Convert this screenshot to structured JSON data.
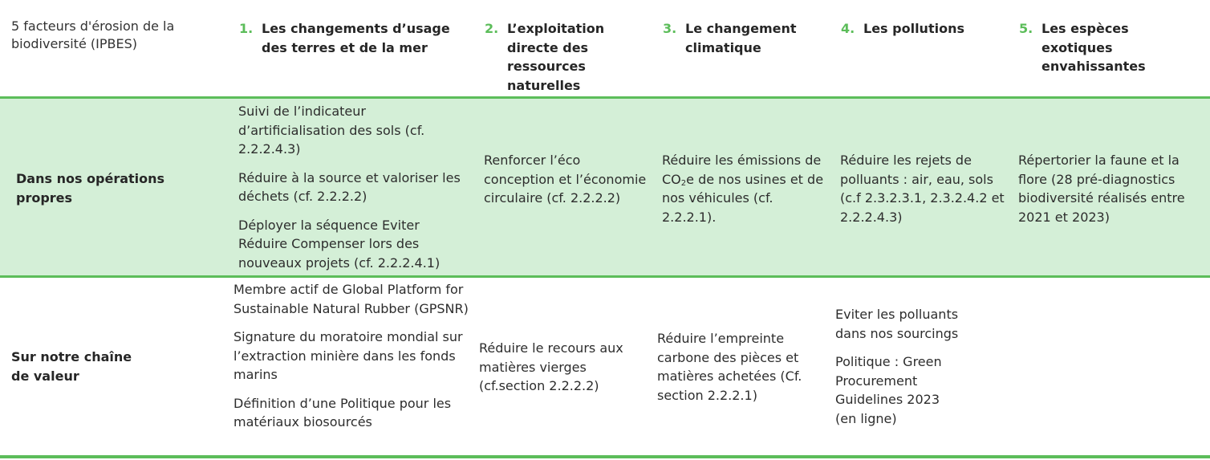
{
  "colors": {
    "accent": "#5cbd5a",
    "row_fill": "#d4efd7"
  },
  "header": {
    "label": "5 facteurs d'érosion de la biodiversité (IPBES)",
    "columns": [
      {
        "num": "1.",
        "title": "Les changements d’usage des terres et de la mer"
      },
      {
        "num": "2.",
        "title": "L’exploitation directe des ressources naturelles"
      },
      {
        "num": "3.",
        "title": "Le changement climatique"
      },
      {
        "num": "4.",
        "title": "Les pollutions"
      },
      {
        "num": "5.",
        "title": "Les espèces exotiques envahissantes"
      }
    ]
  },
  "rows": [
    {
      "label": "Dans nos opérations propres",
      "cells": [
        [
          "Suivi de l’indicateur d’artificialisation des sols (cf. 2.2.2.4.3)",
          "Réduire à la source et valoriser les déchets (cf. 2.2.2.2)",
          "Déployer la séquence Eviter Réduire Compenser lors des nouveaux projets (cf. 2.2.2.4.1)"
        ],
        [
          "Renforcer l’éco conception et l’économie circulaire (cf. 2.2.2.2)"
        ],
        [
          {
            "before": "Réduire les émissions de CO",
            "sub": "2",
            "after": "e de nos usines et de nos véhicules (cf. 2.2.2.1)."
          }
        ],
        [
          "Réduire les rejets de polluants : air, eau, sols (c.f 2.3.2.3.1, 2.3.2.4.2 et 2.2.2.4.3)"
        ],
        [
          "Répertorier la faune et la flore (28 pré-diagnostics biodiversité réalisés entre 2021 et 2023)"
        ]
      ]
    },
    {
      "label": "Sur notre chaîne de valeur",
      "cells": [
        [
          "Membre actif de Global Platform for Sustainable Natural Rubber (GPSNR)",
          "Signature du moratoire mondial sur l’extraction minière dans les fonds marins",
          "Définition d’une Politique pour les matériaux biosourcés"
        ],
        [
          "Réduire le recours aux matières vierges (cf.section 2.2.2.2)"
        ],
        [
          "Réduire l’empreinte carbone des pièces et matières achetées (Cf. section 2.2.2.1)"
        ],
        [
          "Eviter les polluants dans nos sourcings",
          "Politique : Green Procurement Guidelines 2023 (en ligne)"
        ],
        []
      ]
    }
  ]
}
